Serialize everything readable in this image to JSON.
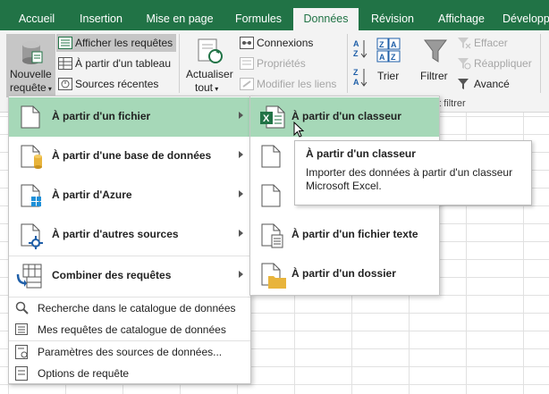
{
  "tabs": [
    {
      "label": "Accueil",
      "active": false
    },
    {
      "label": "Insertion",
      "active": false
    },
    {
      "label": "Mise en page",
      "active": false
    },
    {
      "label": "Formules",
      "active": false
    },
    {
      "label": "Données",
      "active": true
    },
    {
      "label": "Révision",
      "active": false
    },
    {
      "label": "Affichage",
      "active": false
    },
    {
      "label": "Développ",
      "active": false
    }
  ],
  "ribbon": {
    "nouvelle_requete": {
      "line1": "Nouvelle",
      "line2": "requête"
    },
    "afficher_requetes": "Afficher les requêtes",
    "a_partir_tableau": "À partir d'un tableau",
    "sources_recentes": "Sources récentes",
    "actualiser": {
      "line1": "Actualiser",
      "line2": "tout"
    },
    "connexions": "Connexions",
    "proprietes": "Propriétés",
    "modifier_liens": "Modifier les liens",
    "trier": "Trier",
    "filtrer": "Filtrer",
    "effacer": "Effacer",
    "reappliquer": "Réappliquer",
    "avance": "Avancé",
    "group_trier_filtrer": "et filtrer"
  },
  "menu": {
    "items": [
      {
        "label": "À partir d'un fichier",
        "icon": "file-icon",
        "has_submenu": true,
        "selected": true
      },
      {
        "label": "À partir d'une base de données",
        "icon": "database-file-icon",
        "has_submenu": true,
        "selected": false
      },
      {
        "label": "À partir d'Azure",
        "icon": "azure-file-icon",
        "has_submenu": true,
        "selected": false
      },
      {
        "label": "À partir d'autres sources",
        "icon": "other-sources-icon",
        "has_submenu": true,
        "selected": false
      },
      {
        "label": "Combiner des requêtes",
        "icon": "combine-queries-icon",
        "has_submenu": true,
        "selected": false
      }
    ],
    "small_items": [
      {
        "label": "Recherche dans le catalogue de données",
        "icon": "catalog-search-icon"
      },
      {
        "label": "Mes requêtes de catalogue de données",
        "icon": "catalog-queries-icon"
      },
      {
        "label": "Paramètres des sources de données...",
        "icon": "data-source-settings-icon"
      },
      {
        "label": "Options de requête",
        "icon": "query-options-icon"
      }
    ]
  },
  "submenu": {
    "items": [
      {
        "label": "À partir d'un classeur",
        "icon": "excel-workbook-icon",
        "selected": true
      },
      {
        "label": "À partir d'un fichier texte",
        "icon": "text-file-icon",
        "selected": false
      },
      {
        "label": "À partir d'un dossier",
        "icon": "folder-icon",
        "selected": false
      }
    ]
  },
  "tooltip": {
    "title": "À partir d'un classeur",
    "body": "Importer des données à partir d'un classeur Microsoft Excel."
  },
  "colors": {
    "excel_green": "#217346",
    "selection": "#a6d8b8"
  }
}
